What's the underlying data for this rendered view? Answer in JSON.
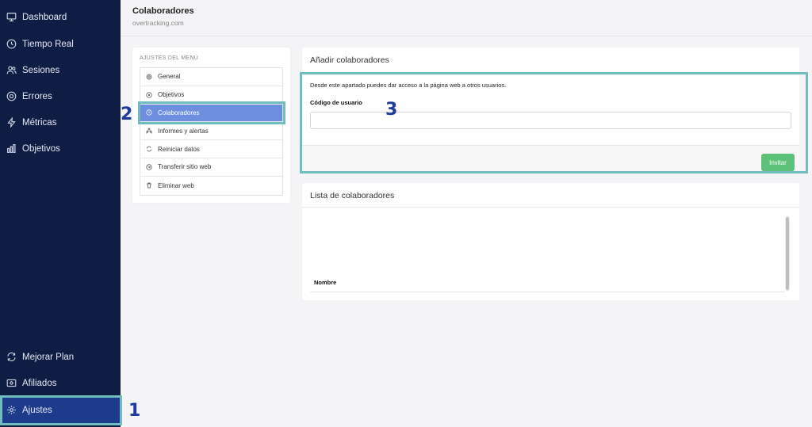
{
  "sidebar": {
    "top_items": [
      {
        "label": "Dashboard",
        "icon": "monitor-icon"
      },
      {
        "label": "Tiempo Real",
        "icon": "clock-icon"
      },
      {
        "label": "Sesiones",
        "icon": "users-icon"
      },
      {
        "label": "Errores",
        "icon": "alert-circle-icon"
      },
      {
        "label": "Métricas",
        "icon": "zap-icon"
      },
      {
        "label": "Objetivos",
        "icon": "bar-chart-icon"
      }
    ],
    "bottom_items": [
      {
        "label": "Mejorar Plan",
        "icon": "refresh-icon"
      },
      {
        "label": "Afiliados",
        "icon": "credit-card-icon"
      },
      {
        "label": "Ajustes",
        "icon": "gear-icon",
        "active": true
      }
    ],
    "background": "#0f1d45",
    "active_background": "#1e3a8a"
  },
  "header": {
    "title": "Colaboradores",
    "subtitle": "overtracking.com"
  },
  "settings_menu": {
    "heading": "AJUSTES DEL MENÚ",
    "items": [
      {
        "label": "General",
        "icon": "gear-icon"
      },
      {
        "label": "Objetivos",
        "icon": "target-icon"
      },
      {
        "label": "Colaboradores",
        "icon": "clock-icon",
        "active": true
      },
      {
        "label": "Informes y alertas",
        "icon": "people-icon"
      },
      {
        "label": "Reiniciar datos",
        "icon": "refresh-icon"
      },
      {
        "label": "Transferir sitio web",
        "icon": "arrow-circle-icon"
      },
      {
        "label": "Eliminar web",
        "icon": "trash-icon"
      }
    ],
    "active_color": "#6e8fdf"
  },
  "add_collaborators": {
    "title": "Añadir colaboradores",
    "description": "Desde este apartado puedes dar acceso a la página web a otros usuarios.",
    "field_label": "Código de usuario",
    "field_value": "",
    "invite_label": "Invitar",
    "invite_color": "#5cc27a"
  },
  "collaborators_list": {
    "title": "Lista de colaboradores",
    "columns": [
      "Nombre"
    ]
  },
  "annotations": {
    "one": "1",
    "two": "2",
    "three": "3",
    "color": "#1e3a9e",
    "box_color": "#6fbdbd"
  }
}
